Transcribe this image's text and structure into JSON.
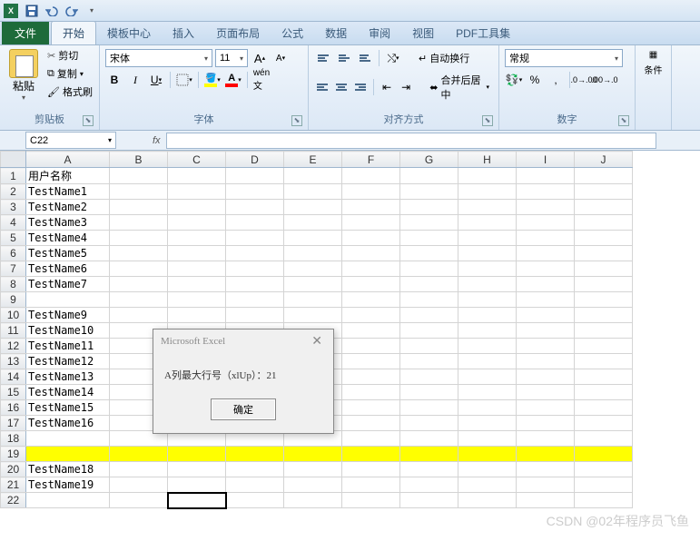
{
  "qat": {
    "excel_letter": "X"
  },
  "tabs": {
    "file": "文件",
    "items": [
      "开始",
      "模板中心",
      "插入",
      "页面布局",
      "公式",
      "数据",
      "审阅",
      "视图",
      "PDF工具集"
    ],
    "active_index": 0
  },
  "ribbon": {
    "clipboard": {
      "paste": "粘贴",
      "cut": "剪切",
      "copy": "复制",
      "format_painter": "格式刷",
      "group_label": "剪贴板"
    },
    "font": {
      "name": "宋体",
      "size": "11",
      "group_label": "字体",
      "bold": "B",
      "italic": "I",
      "underline": "U",
      "grow": "A",
      "shrink": "A"
    },
    "alignment": {
      "wrap_text": "自动换行",
      "merge_center": "合并后居中",
      "group_label": "对齐方式"
    },
    "number": {
      "format": "常规",
      "group_label": "数字"
    },
    "styles": {
      "cond_format": "条件"
    }
  },
  "formula_bar": {
    "name_box": "C22",
    "fx": "fx",
    "value": ""
  },
  "grid": {
    "columns": [
      "A",
      "B",
      "C",
      "D",
      "E",
      "F",
      "G",
      "H",
      "I",
      "J"
    ],
    "rows": [
      {
        "n": 1,
        "A": "用户名称"
      },
      {
        "n": 2,
        "A": "TestName1"
      },
      {
        "n": 3,
        "A": "TestName2"
      },
      {
        "n": 4,
        "A": "TestName3"
      },
      {
        "n": 5,
        "A": "TestName4"
      },
      {
        "n": 6,
        "A": "TestName5"
      },
      {
        "n": 7,
        "A": "TestName6"
      },
      {
        "n": 8,
        "A": "TestName7"
      },
      {
        "n": 9,
        "A": ""
      },
      {
        "n": 10,
        "A": "TestName9"
      },
      {
        "n": 11,
        "A": "TestName10"
      },
      {
        "n": 12,
        "A": "TestName11"
      },
      {
        "n": 13,
        "A": "TestName12"
      },
      {
        "n": 14,
        "A": "TestName13"
      },
      {
        "n": 15,
        "A": "TestName14"
      },
      {
        "n": 16,
        "A": "TestName15"
      },
      {
        "n": 17,
        "A": "TestName16"
      },
      {
        "n": 18,
        "A": ""
      },
      {
        "n": 19,
        "A": "",
        "highlight": true
      },
      {
        "n": 20,
        "A": "TestName18"
      },
      {
        "n": 21,
        "A": "TestName19"
      },
      {
        "n": 22,
        "A": "",
        "selected_col": "C"
      }
    ]
  },
  "dialog": {
    "title": "Microsoft Excel",
    "message": "A列最大行号（xlUp）：21",
    "ok": "确定"
  },
  "watermark": "CSDN @02年程序员飞鱼"
}
